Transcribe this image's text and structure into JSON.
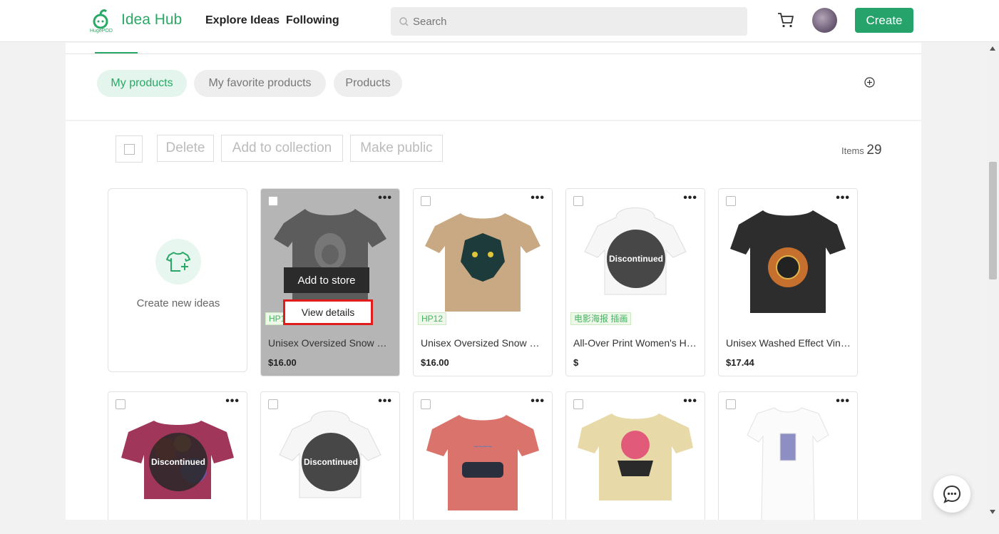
{
  "header": {
    "brand": "Idea Hub",
    "logo_sub": "HugePOD",
    "nav": [
      "Explore Ideas",
      "Following"
    ],
    "search_placeholder": "Search",
    "create_label": "Create"
  },
  "tabs": {
    "items": [
      {
        "label": "My products",
        "active": true
      },
      {
        "label": "My favorite products",
        "active": false
      },
      {
        "label": "Products",
        "active": false
      }
    ]
  },
  "toolbar": {
    "delete_label": "Delete",
    "add_collection_label": "Add to collection",
    "make_public_label": "Make public",
    "items_label": "Items",
    "items_count": "29"
  },
  "create_card": {
    "label": "Create new ideas"
  },
  "overlay": {
    "add_to_store": "Add to store",
    "view_details": "View details"
  },
  "discontinued_label": "Discontinued",
  "products": [
    {
      "title": "Unisex Oversized Snow Wash T-Shirt",
      "price": "$16.00",
      "tag": "HP12",
      "image": "dark-tshirt-monster"
    },
    {
      "title": "Unisex Oversized Snow Wash T-Shirt",
      "price": "$16.00",
      "tag": "HP12",
      "image": "tan-tshirt-wolf"
    },
    {
      "title": "All-Over Print Women's Hoodie",
      "price": "$",
      "tag": "电影海报 插画",
      "image": "white-hoodie",
      "discontinued": true
    },
    {
      "title": "Unisex Washed Effect Vintage T-Shirt",
      "price": "$17.44",
      "image": "black-tshirt-boxer"
    },
    {
      "image": "crop-top-red",
      "discontinued": true
    },
    {
      "image": "white-hoodie-2",
      "discontinued": true
    },
    {
      "image": "red-tshirt-car"
    },
    {
      "image": "beige-tshirt-sunset"
    },
    {
      "image": "white-dress-card"
    }
  ],
  "colors": {
    "accent": "#25a36b",
    "highlight": "#e21b1b"
  }
}
